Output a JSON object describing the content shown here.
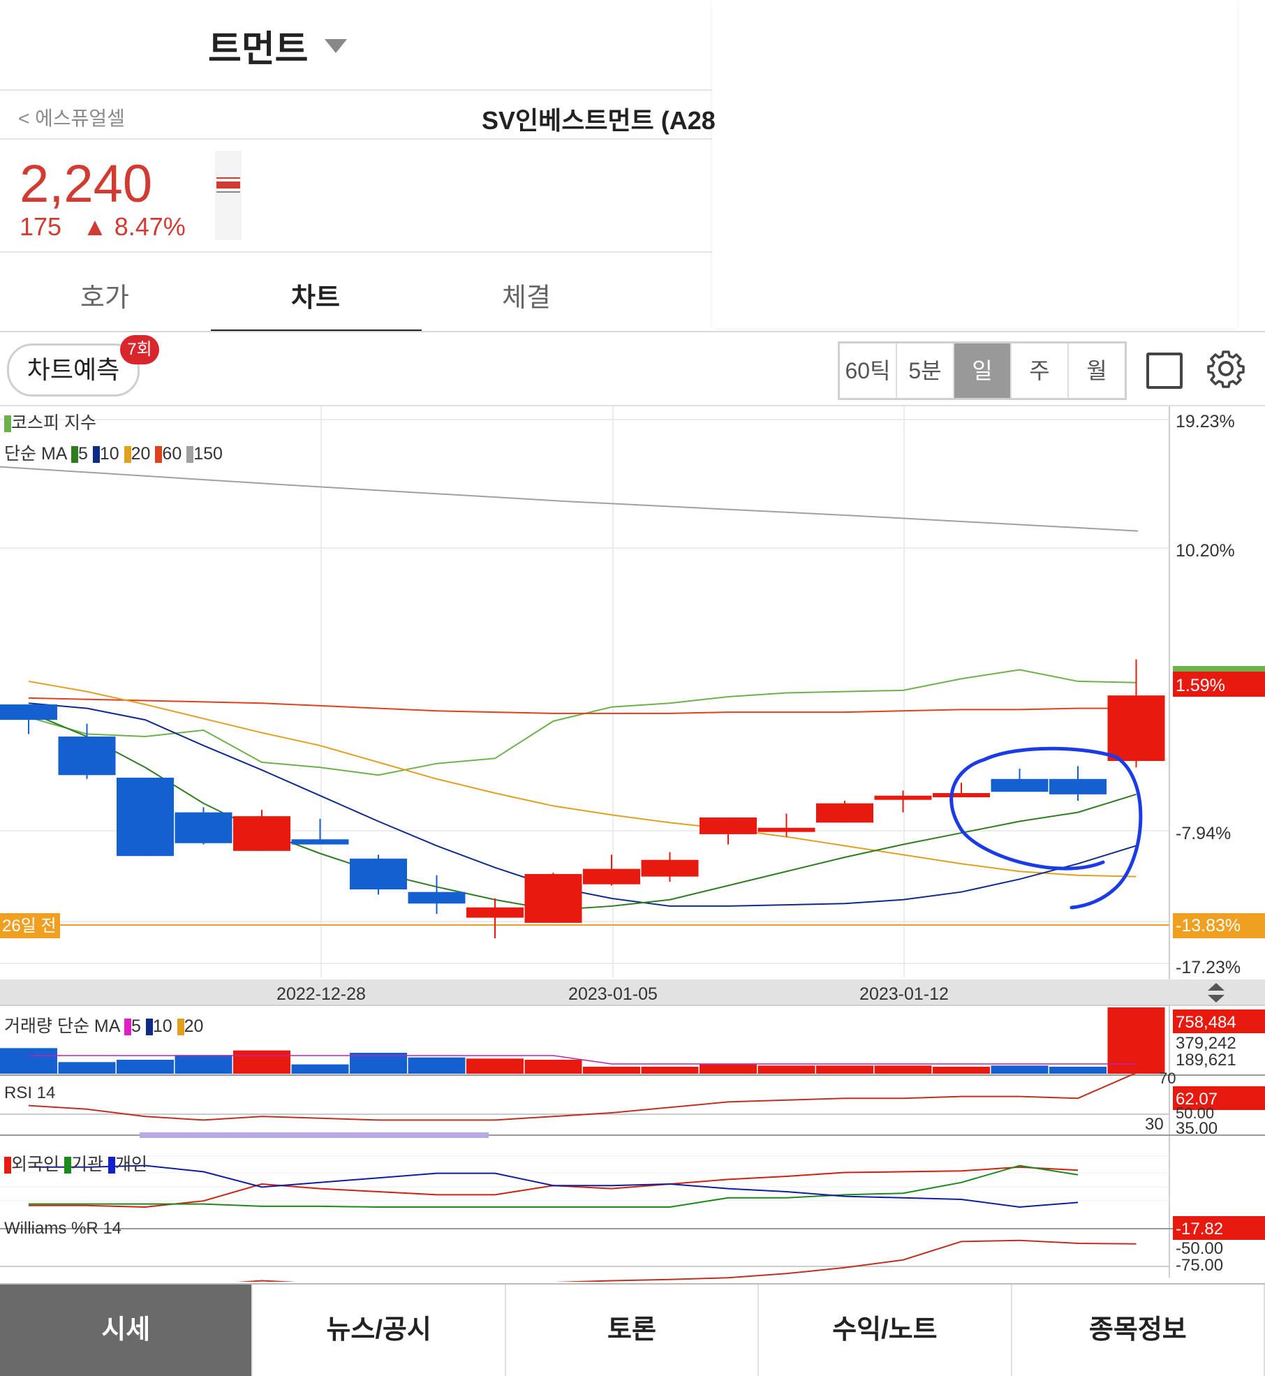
{
  "header": {
    "title": "트먼트"
  },
  "stock": {
    "back_label": "에스퓨얼셀",
    "name": "SV인베스트먼트 (A28",
    "price": "2,240",
    "change": "175",
    "change_pct": "▲ 8.47%"
  },
  "tabs": [
    "호가",
    "차트",
    "체결"
  ],
  "toolbar": {
    "predict_label": "차트예측",
    "predict_badge": "7회",
    "periods": [
      "60틱",
      "5분",
      "일",
      "주",
      "월"
    ],
    "selected_period": "일"
  },
  "colors": {
    "up": "#e8190e",
    "down": "#1560d0",
    "ma5": "#2e7d1e",
    "ma10": "#0d2b8a",
    "ma20": "#e0a020",
    "ma60": "#e0401a",
    "ma150": "#a0a0a0",
    "kospi": "#6cb24a",
    "ref": "#f0a020",
    "annotation": "#1a3ce8"
  },
  "legends": {
    "kospi": "코스피 지수",
    "ma": {
      "label": "단순 MA",
      "periods": [
        "5",
        "10",
        "20",
        "60",
        "150"
      ]
    },
    "volume": {
      "label": "거래량 단순 MA",
      "periods": [
        "5",
        "10",
        "20"
      ]
    },
    "rsi": "RSI 14",
    "investors": [
      "외국인",
      "기관",
      "개인"
    ],
    "williams": "Williams %R 14"
  },
  "chart_data": {
    "type": "candlestick",
    "x_ticks": [
      "2022-12-28",
      "2023-01-05",
      "2023-01-12"
    ],
    "y_axis_pct": [
      "19.23%",
      "10.20%",
      "-7.94%",
      "-13.83%",
      "-17.23%"
    ],
    "current_label": "1.59%",
    "ref_label": "-13.83%",
    "ref_left_label": "26일 전",
    "candles_pct": [
      {
        "o": 0.5,
        "c": -0.7,
        "h": 0.2,
        "l": -1.8
      },
      {
        "o": -2.0,
        "c": -5.0,
        "h": -1.0,
        "l": -5.3
      },
      {
        "o": -5.2,
        "c": -11.3,
        "h": -5.2,
        "l": -11.3
      },
      {
        "o": -7.9,
        "c": -10.3,
        "h": -7.5,
        "l": -10.4
      },
      {
        "o": -10.9,
        "c": -8.2,
        "h": -7.7,
        "l": -10.9
      },
      {
        "o": -10.0,
        "c": -10.4,
        "h": -8.4,
        "l": -10.4
      },
      {
        "o": -11.5,
        "c": -13.9,
        "h": -11.2,
        "l": -14.3
      },
      {
        "o": -14.1,
        "c": -15.0,
        "h": -12.8,
        "l": -15.8
      },
      {
        "o": -16.1,
        "c": -15.3,
        "h": -14.6,
        "l": -17.7
      },
      {
        "o": -16.5,
        "c": -12.7,
        "h": -12.6,
        "l": -16.5
      },
      {
        "o": -13.5,
        "c": -12.3,
        "h": -11.2,
        "l": -13.6
      },
      {
        "o": -12.9,
        "c": -11.6,
        "h": -11.0,
        "l": -13.3
      },
      {
        "o": -9.6,
        "c": -8.3,
        "h": -8.3,
        "l": -10.4
      },
      {
        "o": -9.2,
        "c": -9.1,
        "h": -8.0,
        "l": -9.8
      },
      {
        "o": -8.7,
        "c": -7.2,
        "h": -7.0,
        "l": -8.7
      },
      {
        "o": -6.7,
        "c": -6.6,
        "h": -6.2,
        "l": -7.9
      },
      {
        "o": -6.6,
        "c": -6.4,
        "h": -5.6,
        "l": -6.7
      },
      {
        "o": -5.3,
        "c": -6.3,
        "h": -4.5,
        "l": -5.3
      },
      {
        "o": -5.3,
        "c": -6.5,
        "h": -4.3,
        "l": -7.0
      },
      {
        "o": -3.9,
        "c": 1.2,
        "h": 4.0,
        "l": -4.4
      }
    ],
    "ma5_pct": [
      -0.1,
      -2.0,
      -4.4,
      -7.2,
      -9.4,
      -11.1,
      -12.6,
      -13.7,
      -14.7,
      -15.5,
      -15.2,
      -14.7,
      -13.6,
      -12.5,
      -11.4,
      -10.4,
      -9.5,
      -8.6,
      -7.9,
      -6.5
    ],
    "ma10_pct": [
      0.6,
      0.2,
      -0.7,
      -2.7,
      -4.6,
      -6.6,
      -8.6,
      -10.5,
      -12.2,
      -13.7,
      -14.6,
      -15.2,
      -15.2,
      -15.1,
      -15.0,
      -14.7,
      -14.1,
      -13.1,
      -11.9,
      -10.5
    ],
    "ma20_pct": [
      2.3,
      1.5,
      0.5,
      -0.6,
      -1.7,
      -2.7,
      -4.0,
      -5.3,
      -6.4,
      -7.4,
      -8.1,
      -8.7,
      -9.2,
      -9.8,
      -10.5,
      -11.2,
      -11.9,
      -12.5,
      -12.8,
      -12.9
    ],
    "ma60_pct": [
      1.0,
      0.9,
      0.8,
      0.7,
      0.6,
      0.4,
      0.2,
      0.0,
      -0.1,
      -0.2,
      -0.2,
      -0.2,
      -0.1,
      -0.1,
      -0.1,
      0.0,
      0.1,
      0.1,
      0.2,
      0.2
    ],
    "ma150_pct": [
      19.0,
      17.6,
      16.3,
      15.2,
      14.0
    ],
    "kospi_pct": [
      -0.5,
      -1.8,
      -2.0,
      -1.5,
      -4.0,
      -4.4,
      -5.0,
      -4.1,
      -3.7,
      -0.8,
      0.3,
      0.6,
      1.1,
      1.4,
      1.5,
      1.6,
      2.5,
      3.2,
      2.3,
      2.2
    ],
    "volume": {
      "labels": [
        "758,484",
        "379,242",
        "189,621"
      ],
      "values": [
        220,
        100,
        120,
        160,
        200,
        80,
        180,
        140,
        130,
        120,
        60,
        60,
        80,
        70,
        70,
        70,
        60,
        70,
        60,
        758
      ]
    },
    "rsi": {
      "value_label": "62.07",
      "ticks": [
        "70",
        "50.00",
        "35.00",
        "30"
      ],
      "values": [
        44,
        42,
        38,
        36,
        38,
        37,
        36,
        36,
        36,
        38,
        40,
        43,
        46,
        47,
        48,
        48,
        49,
        49,
        48,
        62
      ]
    },
    "investors": {
      "foreign": [
        12,
        12,
        10,
        18,
        40,
        34,
        30,
        26,
        26,
        38,
        34,
        40,
        46,
        50,
        55,
        56,
        57,
        62,
        58,
        null
      ],
      "institution": [
        14,
        14,
        14,
        14,
        11,
        11,
        10,
        10,
        10,
        10,
        10,
        10,
        22,
        22,
        26,
        28,
        42,
        64,
        52,
        null
      ],
      "individual": [
        62,
        62,
        64,
        56,
        36,
        42,
        48,
        54,
        54,
        38,
        38,
        40,
        34,
        30,
        24,
        22,
        20,
        10,
        16,
        null
      ]
    },
    "williams": {
      "value_label": "-17.82",
      "ticks": [
        "-50.00",
        "-75.00"
      ],
      "values": [
        -96,
        -97,
        -98,
        -97,
        -90,
        -95,
        -96,
        -96,
        -96,
        -93,
        -90,
        -88,
        -85,
        -78,
        -68,
        -55,
        -24,
        -22,
        -27,
        -28
      ]
    }
  },
  "bottom_nav": [
    "시세",
    "뉴스/공시",
    "토론",
    "수익/노트",
    "종목정보"
  ]
}
